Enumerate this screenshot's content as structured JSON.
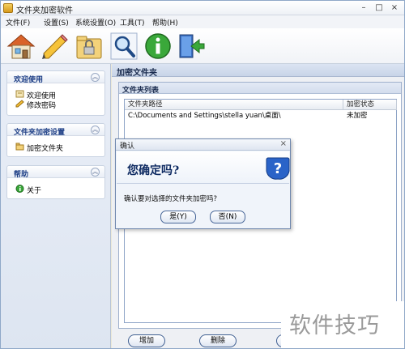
{
  "window": {
    "title": "文件夹加密软件",
    "min": "–",
    "max": "□",
    "close": "×"
  },
  "menu": [
    {
      "label": "文件(F)"
    },
    {
      "label": "设置(S)"
    },
    {
      "label": "系统设置(O)"
    },
    {
      "label": "工具(T)"
    },
    {
      "label": "帮助(H)"
    }
  ],
  "toolbar": {
    "icons": [
      "home-icon",
      "pencil-icon",
      "lock-icon",
      "magnifier-icon",
      "info-icon",
      "exit-icon"
    ]
  },
  "sidebar": {
    "collapse_glyph": "︽",
    "groups": [
      {
        "title": "欢迎使用",
        "items": [
          {
            "label": "欢迎使用",
            "icon": "welcome-icon"
          },
          {
            "label": "修改密码",
            "icon": "pen-icon"
          }
        ]
      },
      {
        "title": "文件夹加密设置",
        "items": [
          {
            "label": "加密文件夹",
            "icon": "folder-icon"
          }
        ]
      },
      {
        "title": "帮助",
        "items": [
          {
            "label": "关于",
            "icon": "about-icon"
          }
        ]
      }
    ]
  },
  "main": {
    "title": "加密文件夹",
    "list_title": "文件夹列表",
    "columns": [
      "文件夹路径",
      "加密状态"
    ],
    "rows": [
      {
        "path": "C:\\Documents and Settings\\stella yuan\\桌面\\",
        "status": "未加密"
      }
    ],
    "buttons": {
      "add": "增加",
      "delete": "删除"
    }
  },
  "dialog": {
    "title": "确认",
    "close": "×",
    "question": "您确定吗?",
    "message": "确认要对选择的文件夹加密吗?",
    "yes": "是(Y)",
    "no": "否(N)"
  },
  "watermark": {
    "text": "软件技巧"
  },
  "colors": {
    "accent": "#1e3f86",
    "window_bg": "#ece9d8",
    "question_icon": "#2a63c8"
  }
}
